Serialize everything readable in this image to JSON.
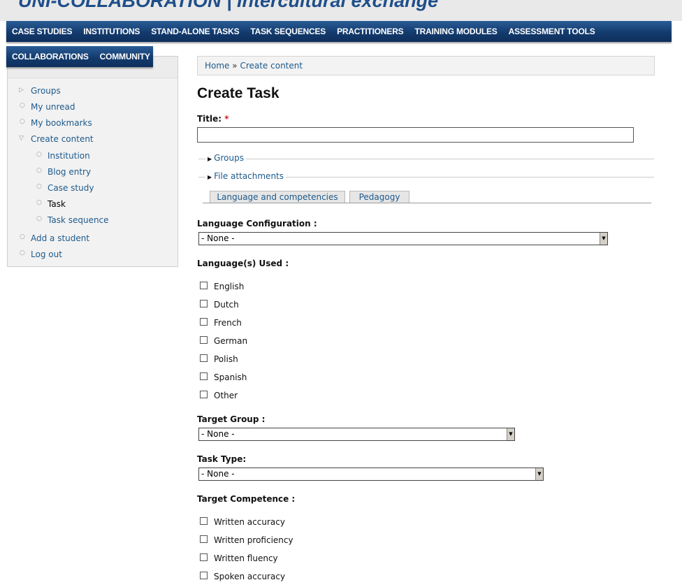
{
  "site": {
    "title": "UNI-COLLABORATION | Intercultural exchange"
  },
  "nav": {
    "primary": [
      "CASE STUDIES",
      "INSTITUTIONS",
      "STAND-ALONE TASKS",
      "TASK SEQUENCES",
      "PRACTITIONERS",
      "TRAINING MODULES",
      "ASSESSMENT TOOLS"
    ],
    "secondary": [
      "COLLABORATIONS",
      "COMMUNITY"
    ]
  },
  "sidebar": {
    "items": [
      {
        "label": "Groups",
        "bullet": "▷"
      },
      {
        "label": "My unread",
        "bullet": "○"
      },
      {
        "label": "My bookmarks",
        "bullet": "○"
      },
      {
        "label": "Create content",
        "bullet": "▽"
      },
      {
        "label": "Institution",
        "bullet": "○"
      },
      {
        "label": "Blog entry",
        "bullet": "○"
      },
      {
        "label": "Case study",
        "bullet": "○"
      },
      {
        "label": "Task",
        "bullet": "○"
      },
      {
        "label": "Task sequence",
        "bullet": "○"
      },
      {
        "label": "Add a student",
        "bullet": "○"
      },
      {
        "label": "Log out",
        "bullet": "○"
      }
    ]
  },
  "breadcrumb": {
    "home": "Home",
    "separator": "»",
    "current": "Create content"
  },
  "page": {
    "title": "Create Task"
  },
  "form": {
    "title_label": "Title:",
    "required_mark": "*",
    "title_value": "",
    "fieldsets": [
      "Groups",
      "File attachments"
    ],
    "tabs": [
      "Language and competencies",
      "Pedagogy"
    ],
    "language_configuration": {
      "label": "Language Configuration :",
      "value": "- None -"
    },
    "languages_used": {
      "label": "Language(s) Used :",
      "options": [
        "English",
        "Dutch",
        "French",
        "German",
        "Polish",
        "Spanish",
        "Other"
      ]
    },
    "target_group": {
      "label": "Target Group :",
      "value": "- None -"
    },
    "task_type": {
      "label": "Task Type:",
      "value": "- None -"
    },
    "target_competence": {
      "label": "Target Competence :",
      "options": [
        "Written accuracy",
        "Written proficiency",
        "Written fluency",
        "Spoken accuracy"
      ]
    }
  },
  "colors": {
    "nav_bg": "#133b6e",
    "link": "#1d5a8c",
    "title": "#1f4f8a",
    "required": "#cc2222"
  }
}
